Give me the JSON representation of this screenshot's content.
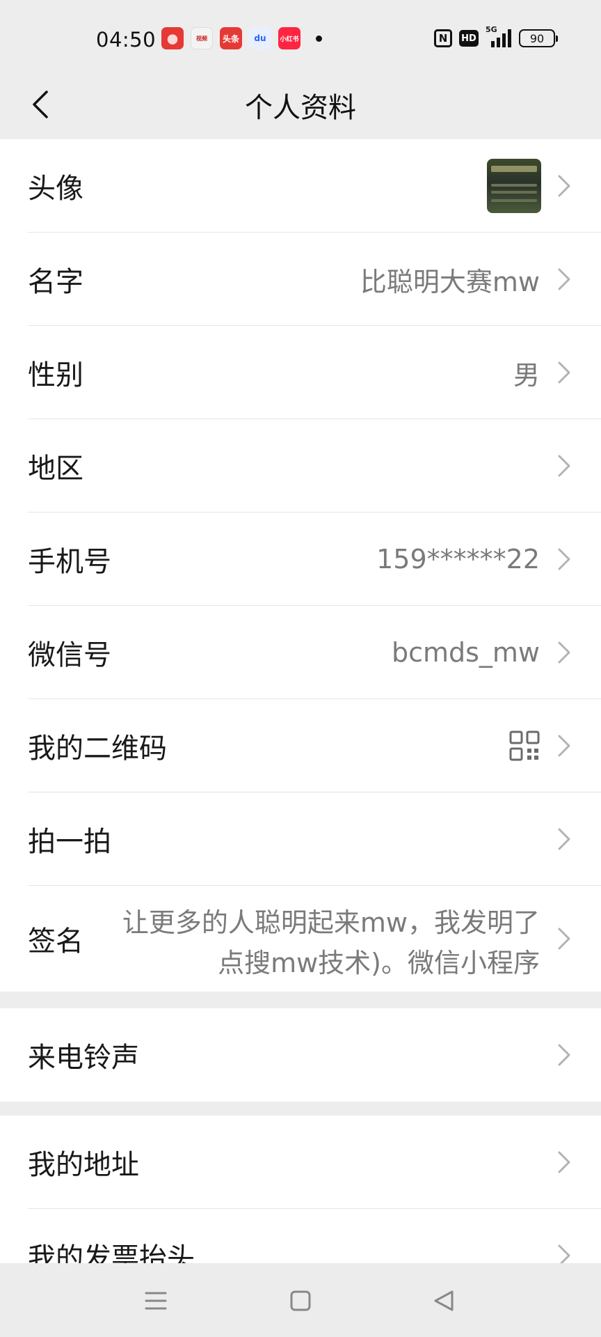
{
  "status_bar": {
    "time": "04:50",
    "app_icons": [
      "pinduoduo-icon",
      "news-app-icon",
      "toutiao-icon",
      "baidu-icon",
      "xiaohongshu-icon"
    ],
    "app_icon_texts": [
      "",
      "视频",
      "头条",
      "du",
      "小红书"
    ],
    "indicators": {
      "nfc": "N",
      "hd": "HD",
      "network": "5G"
    },
    "battery": "90"
  },
  "nav": {
    "title": "个人资料",
    "back_icon": "chevron-left-icon"
  },
  "profile": {
    "avatar_label": "头像",
    "name_label": "名字",
    "name_value": "比聪明大赛mw",
    "gender_label": "性别",
    "gender_value": "男",
    "region_label": "地区",
    "region_value": "",
    "phone_label": "手机号",
    "phone_value": "159******22",
    "wechat_id_label": "微信号",
    "wechat_id_value": "bcmds_mw",
    "qrcode_label": "我的二维码",
    "pat_label": "拍一拍",
    "signature_label": "签名",
    "signature_line1": "让更多的人聪明起来mw，我发明了",
    "signature_line2": "点搜mw技术)。微信小程序"
  },
  "ringtone": {
    "label": "来电铃声"
  },
  "addresses": {
    "address_label": "我的地址",
    "invoice_label": "我的发票抬头"
  },
  "colors": {
    "page_bg": "#ededed",
    "card_bg": "#ffffff",
    "value_text": "#7a7a7a",
    "divider": "#e5e5e5"
  },
  "system_nav": {
    "menu_icon": "menu-icon",
    "home_icon": "home-square-icon",
    "back_icon": "back-triangle-icon"
  }
}
